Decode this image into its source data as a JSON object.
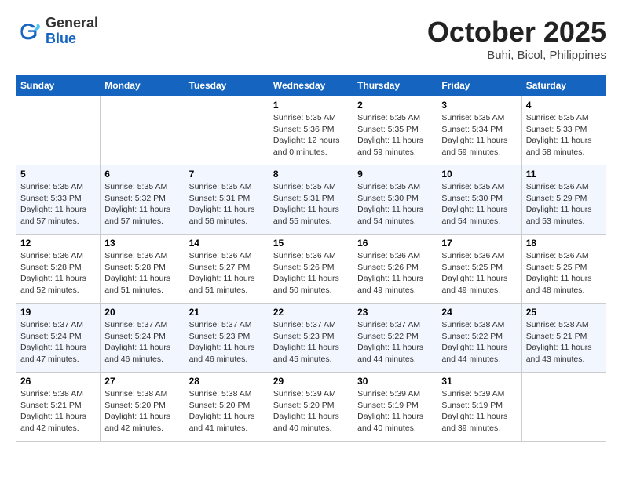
{
  "header": {
    "logo_general": "General",
    "logo_blue": "Blue",
    "month_title": "October 2025",
    "location": "Buhi, Bicol, Philippines"
  },
  "days_of_week": [
    "Sunday",
    "Monday",
    "Tuesday",
    "Wednesday",
    "Thursday",
    "Friday",
    "Saturday"
  ],
  "weeks": [
    [
      {
        "day": "",
        "info": ""
      },
      {
        "day": "",
        "info": ""
      },
      {
        "day": "",
        "info": ""
      },
      {
        "day": "1",
        "info": "Sunrise: 5:35 AM\nSunset: 5:36 PM\nDaylight: 12 hours\nand 0 minutes."
      },
      {
        "day": "2",
        "info": "Sunrise: 5:35 AM\nSunset: 5:35 PM\nDaylight: 11 hours\nand 59 minutes."
      },
      {
        "day": "3",
        "info": "Sunrise: 5:35 AM\nSunset: 5:34 PM\nDaylight: 11 hours\nand 59 minutes."
      },
      {
        "day": "4",
        "info": "Sunrise: 5:35 AM\nSunset: 5:33 PM\nDaylight: 11 hours\nand 58 minutes."
      }
    ],
    [
      {
        "day": "5",
        "info": "Sunrise: 5:35 AM\nSunset: 5:33 PM\nDaylight: 11 hours\nand 57 minutes."
      },
      {
        "day": "6",
        "info": "Sunrise: 5:35 AM\nSunset: 5:32 PM\nDaylight: 11 hours\nand 57 minutes."
      },
      {
        "day": "7",
        "info": "Sunrise: 5:35 AM\nSunset: 5:31 PM\nDaylight: 11 hours\nand 56 minutes."
      },
      {
        "day": "8",
        "info": "Sunrise: 5:35 AM\nSunset: 5:31 PM\nDaylight: 11 hours\nand 55 minutes."
      },
      {
        "day": "9",
        "info": "Sunrise: 5:35 AM\nSunset: 5:30 PM\nDaylight: 11 hours\nand 54 minutes."
      },
      {
        "day": "10",
        "info": "Sunrise: 5:35 AM\nSunset: 5:30 PM\nDaylight: 11 hours\nand 54 minutes."
      },
      {
        "day": "11",
        "info": "Sunrise: 5:36 AM\nSunset: 5:29 PM\nDaylight: 11 hours\nand 53 minutes."
      }
    ],
    [
      {
        "day": "12",
        "info": "Sunrise: 5:36 AM\nSunset: 5:28 PM\nDaylight: 11 hours\nand 52 minutes."
      },
      {
        "day": "13",
        "info": "Sunrise: 5:36 AM\nSunset: 5:28 PM\nDaylight: 11 hours\nand 51 minutes."
      },
      {
        "day": "14",
        "info": "Sunrise: 5:36 AM\nSunset: 5:27 PM\nDaylight: 11 hours\nand 51 minutes."
      },
      {
        "day": "15",
        "info": "Sunrise: 5:36 AM\nSunset: 5:26 PM\nDaylight: 11 hours\nand 50 minutes."
      },
      {
        "day": "16",
        "info": "Sunrise: 5:36 AM\nSunset: 5:26 PM\nDaylight: 11 hours\nand 49 minutes."
      },
      {
        "day": "17",
        "info": "Sunrise: 5:36 AM\nSunset: 5:25 PM\nDaylight: 11 hours\nand 49 minutes."
      },
      {
        "day": "18",
        "info": "Sunrise: 5:36 AM\nSunset: 5:25 PM\nDaylight: 11 hours\nand 48 minutes."
      }
    ],
    [
      {
        "day": "19",
        "info": "Sunrise: 5:37 AM\nSunset: 5:24 PM\nDaylight: 11 hours\nand 47 minutes."
      },
      {
        "day": "20",
        "info": "Sunrise: 5:37 AM\nSunset: 5:24 PM\nDaylight: 11 hours\nand 46 minutes."
      },
      {
        "day": "21",
        "info": "Sunrise: 5:37 AM\nSunset: 5:23 PM\nDaylight: 11 hours\nand 46 minutes."
      },
      {
        "day": "22",
        "info": "Sunrise: 5:37 AM\nSunset: 5:23 PM\nDaylight: 11 hours\nand 45 minutes."
      },
      {
        "day": "23",
        "info": "Sunrise: 5:37 AM\nSunset: 5:22 PM\nDaylight: 11 hours\nand 44 minutes."
      },
      {
        "day": "24",
        "info": "Sunrise: 5:38 AM\nSunset: 5:22 PM\nDaylight: 11 hours\nand 44 minutes."
      },
      {
        "day": "25",
        "info": "Sunrise: 5:38 AM\nSunset: 5:21 PM\nDaylight: 11 hours\nand 43 minutes."
      }
    ],
    [
      {
        "day": "26",
        "info": "Sunrise: 5:38 AM\nSunset: 5:21 PM\nDaylight: 11 hours\nand 42 minutes."
      },
      {
        "day": "27",
        "info": "Sunrise: 5:38 AM\nSunset: 5:20 PM\nDaylight: 11 hours\nand 42 minutes."
      },
      {
        "day": "28",
        "info": "Sunrise: 5:38 AM\nSunset: 5:20 PM\nDaylight: 11 hours\nand 41 minutes."
      },
      {
        "day": "29",
        "info": "Sunrise: 5:39 AM\nSunset: 5:20 PM\nDaylight: 11 hours\nand 40 minutes."
      },
      {
        "day": "30",
        "info": "Sunrise: 5:39 AM\nSunset: 5:19 PM\nDaylight: 11 hours\nand 40 minutes."
      },
      {
        "day": "31",
        "info": "Sunrise: 5:39 AM\nSunset: 5:19 PM\nDaylight: 11 hours\nand 39 minutes."
      },
      {
        "day": "",
        "info": ""
      }
    ]
  ]
}
